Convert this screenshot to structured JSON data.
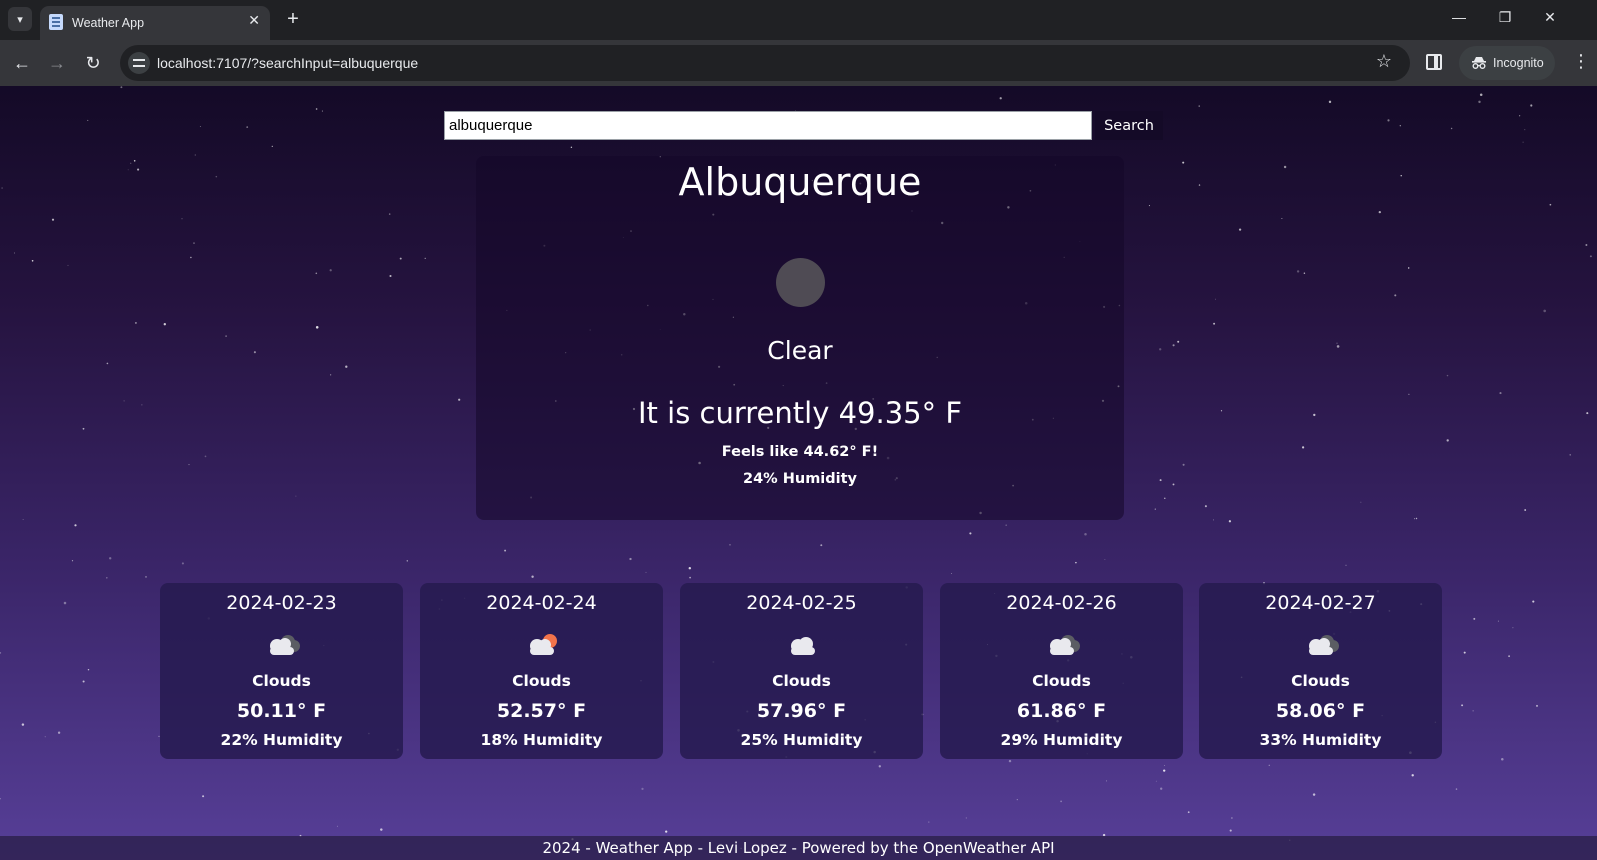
{
  "browser": {
    "tab_title": "Weather App",
    "url": "localhost:7107/?searchInput=albuquerque",
    "profile_label": "Incognito"
  },
  "search": {
    "value": "albuquerque",
    "button_label": "Search"
  },
  "current": {
    "city": "Albuquerque",
    "condition": "Clear",
    "temperature_text": "It is currently 49.35° F",
    "feels_like_text": "Feels like 44.62° F!",
    "humidity_text": "24% Humidity"
  },
  "forecast": [
    {
      "date": "2024-02-23",
      "description": "Clouds",
      "temp": "50.11° F",
      "humidity": "22% Humidity",
      "icon": "broken-clouds-icon"
    },
    {
      "date": "2024-02-24",
      "description": "Clouds",
      "temp": "52.57° F",
      "humidity": "18% Humidity",
      "icon": "few-clouds-sun-icon"
    },
    {
      "date": "2024-02-25",
      "description": "Clouds",
      "temp": "57.96° F",
      "humidity": "25% Humidity",
      "icon": "scattered-clouds-icon"
    },
    {
      "date": "2024-02-26",
      "description": "Clouds",
      "temp": "61.86° F",
      "humidity": "29% Humidity",
      "icon": "broken-clouds-icon"
    },
    {
      "date": "2024-02-27",
      "description": "Clouds",
      "temp": "58.06° F",
      "humidity": "33% Humidity",
      "icon": "broken-clouds-icon"
    }
  ],
  "footer": {
    "text": "2024 - Weather App - Levi Lopez - Powered by the OpenWeather API"
  },
  "colors": {
    "background_top": "#140a27",
    "background_bottom": "#573f98",
    "card": "#241a4e",
    "sun_accent": "#f2734b"
  }
}
